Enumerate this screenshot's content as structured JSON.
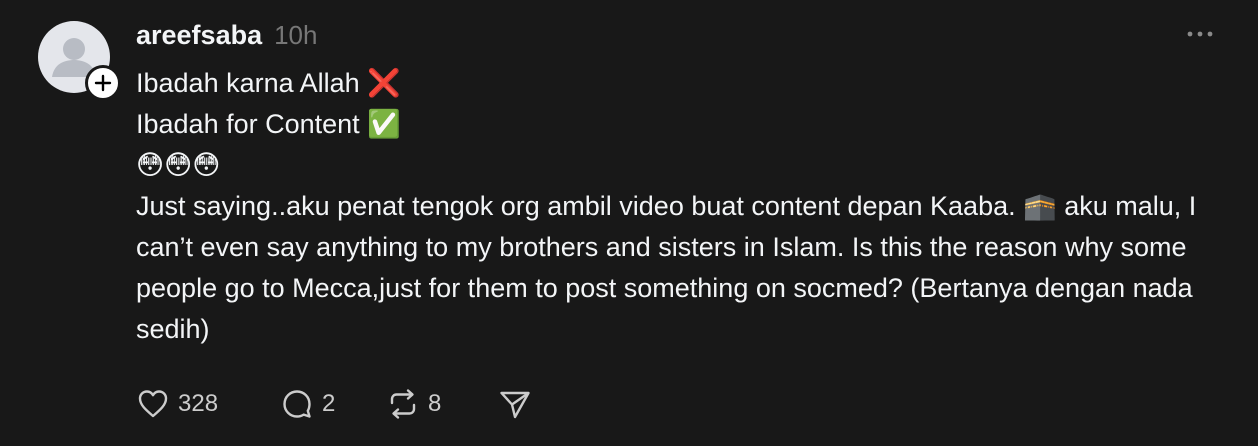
{
  "post": {
    "username": "areefsaba",
    "timestamp": "10h",
    "lines": [
      "Ibadah karna Allah ❌",
      "Ibadah for Content ✅",
      "😳😳😳"
    ],
    "paragraph": "Just saying..aku penat tengok org ambil video buat content depan Kaaba. 🕋 aku malu, I can’t even say anything to my brothers and sisters in Islam. Is this the reason why some people go to Mecca,just for them to post something on socmed? (Bertanya dengan nada sedih)"
  },
  "actions": {
    "likes": "328",
    "replies": "2",
    "reposts": "8"
  },
  "icons": {
    "avatar": "default-user-avatar",
    "follow": "plus-icon",
    "more": "more-horizontal-icon",
    "like": "heart-icon",
    "reply": "comment-icon",
    "repost": "repost-icon",
    "share": "send-icon"
  },
  "colors": {
    "background": "#181818",
    "text": "#f3f5f7",
    "muted": "#777777"
  }
}
